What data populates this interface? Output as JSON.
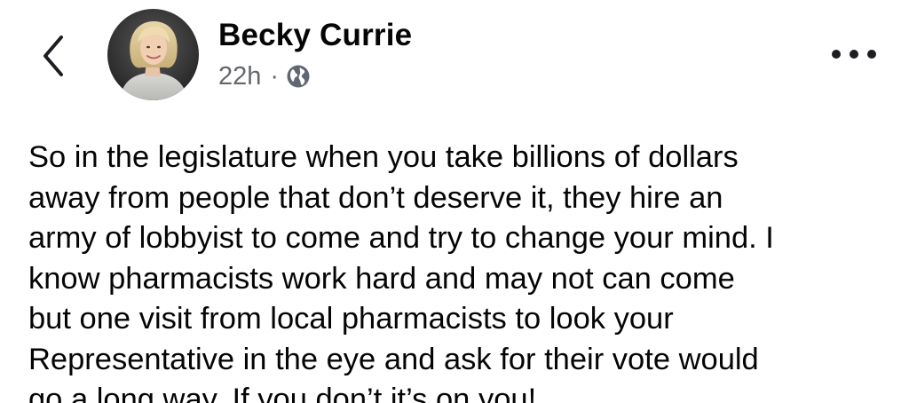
{
  "header": {
    "back_icon": "chevron-left-icon",
    "author_name": "Becky Currie",
    "timestamp": "22h",
    "separator": "·",
    "audience_icon": "globe-icon",
    "more_icon": "more-horizontal-icon"
  },
  "post": {
    "text": "So in the legislature when you take billions of dollars\naway from people that don’t deserve it, they hire an\narmy of lobbyist to come and try to change your mind. I\nknow pharmacists work hard and may not can come\nbut one visit from local pharmacists to look your\nRepresentative in the eye and ask for their vote would\ngo a long way. If you don’t it’s on you!"
  }
}
